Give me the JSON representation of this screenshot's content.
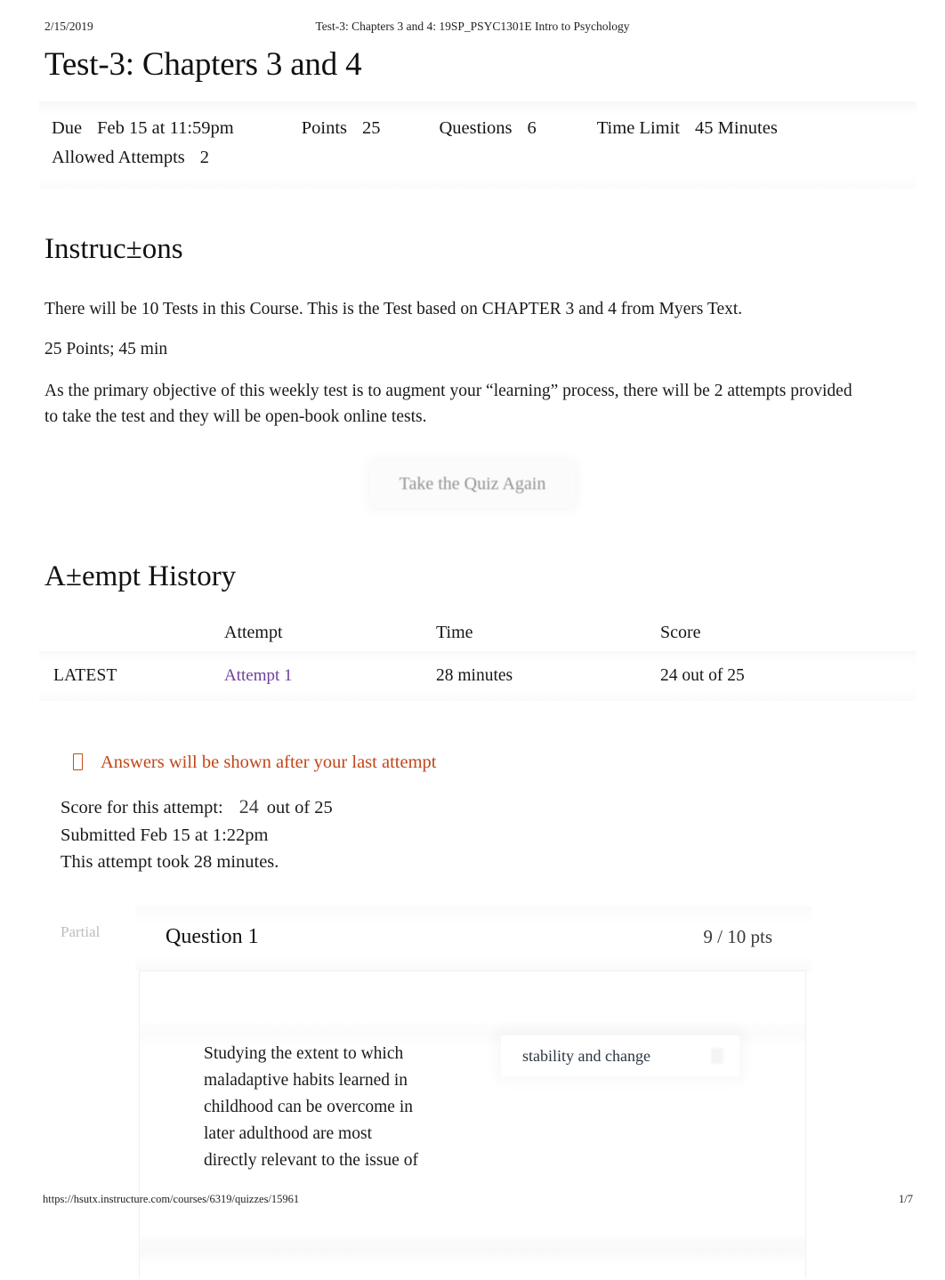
{
  "print_header": {
    "date": "2/15/2019",
    "title": "Test-3: Chapters 3 and 4: 19SP_PSYC1301E Intro to Psychology"
  },
  "print_footer": {
    "url": "https://hsutx.instructure.com/courses/6319/quizzes/15961",
    "page": "1/7"
  },
  "quiz": {
    "title": "Test-3: Chapters 3 and 4",
    "details": {
      "due_label": "Due",
      "due_value": "Feb 15 at 11:59pm",
      "points_label": "Points",
      "points_value": "25",
      "questions_label": "Questions",
      "questions_value": "6",
      "time_limit_label": "Time Limit",
      "time_limit_value": "45 Minutes",
      "allowed_attempts_label": "Allowed Attempts",
      "allowed_attempts_value": "2"
    }
  },
  "instructions": {
    "heading": "Instruc±ons",
    "paragraph_1": "There will be 10 Tests in this Course. This is the Test based on CHAPTER 3 and 4 from Myers Text.",
    "paragraph_2": "25 Points; 45 min",
    "paragraph_3": "As the primary objective of this weekly test is to augment your “learning” process, there will be 2 attempts provided to take the test and they will be open-book online tests."
  },
  "take_quiz_button": {
    "label": "Take the Quiz Again"
  },
  "attempt_history": {
    "heading": "A±empt History",
    "columns": [
      "",
      "Attempt",
      "Time",
      "Score"
    ],
    "rows": [
      {
        "latest": "LATEST",
        "attempt": "Attempt 1",
        "time": "28 minutes",
        "score": "24 out of 25"
      }
    ]
  },
  "answers_notice": {
    "icon": "missing-glyph-box-icon",
    "text": "Answers will be shown after your last attempt",
    "color": "#c0461a"
  },
  "score_summary": {
    "score_label": "Score for this attempt:",
    "score_value": "24",
    "score_suffix": "out of 25",
    "submitted": "Submitted Feb 15 at 1:22pm",
    "duration": "This attempt took 28 minutes."
  },
  "question": {
    "badge": "Partial",
    "label": "Question 1",
    "points": "9 / 10 pts",
    "text": "Studying the extent to which maladaptive habits learned in childhood can be overcome in later adulthood are most directly relevant to the issue of",
    "answer_value": "stability and change"
  },
  "colors": {
    "link_purple": "#6e3f9e",
    "notice_orange": "#c0461a",
    "badge_gray": "#bdbdbd",
    "text": "#1a1a1a"
  }
}
